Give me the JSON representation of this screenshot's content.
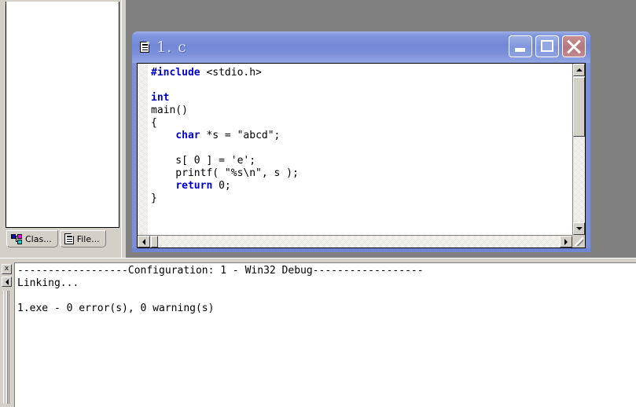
{
  "workspace": {
    "tabs": [
      {
        "label": "Clas...",
        "icon": "classview-icon"
      },
      {
        "label": "File...",
        "icon": "document-icon"
      }
    ]
  },
  "child_window": {
    "title": "1. c",
    "icon": "document-icon",
    "buttons": {
      "minimize": "minimize-button",
      "maximize": "maximize-button",
      "close": "close-button"
    },
    "editor": {
      "lines": [
        [
          {
            "t": "#include",
            "c": "pp"
          },
          {
            "t": " ",
            "c": ""
          },
          {
            "t": "<stdio.h>",
            "c": ""
          }
        ],
        [],
        [
          {
            "t": "int",
            "c": "kw"
          }
        ],
        [
          {
            "t": "main()",
            "c": ""
          }
        ],
        [
          {
            "t": "{",
            "c": ""
          }
        ],
        [
          {
            "t": "    ",
            "c": ""
          },
          {
            "t": "char",
            "c": "kw"
          },
          {
            "t": " *s = \"abcd\";",
            "c": ""
          }
        ],
        [],
        [
          {
            "t": "    s[ 0 ] = 'e';",
            "c": ""
          }
        ],
        [
          {
            "t": "    printf( \"%s\\n\", s );",
            "c": ""
          }
        ],
        [
          {
            "t": "    ",
            "c": ""
          },
          {
            "t": "return",
            "c": "kw"
          },
          {
            "t": " 0;",
            "c": ""
          }
        ],
        [
          {
            "t": "}",
            "c": ""
          }
        ]
      ]
    }
  },
  "output": {
    "close_label": "x",
    "lines": [
      "------------------Configuration: 1 - Win32 Debug------------------",
      "Linking...",
      "",
      "1.exe - 0 error(s), 0 warning(s)"
    ]
  },
  "colors": {
    "keyword": "#0000cc",
    "mdi_background": "#808080",
    "titlebar_blue": "#7c90d8",
    "face": "#d4d0c8",
    "close_button": "#b5787c"
  }
}
